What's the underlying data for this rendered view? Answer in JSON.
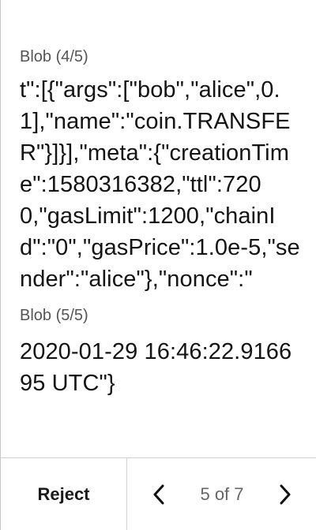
{
  "blob4": {
    "label": "Blob (4/5)",
    "text": "t\":[{\"args\":[\"bob\",\"alice\",0.1],\"name\":\"coin.TRANSFER\"}]}],\"meta\":{\"creationTime\":1580316382,\"ttl\":7200,\"gasLimit\":1200,\"chainId\":\"0\",\"gasPrice\":1.0e-5,\"sender\":\"alice\"},\"nonce\":\""
  },
  "blob5": {
    "label": "Blob (5/5)",
    "text": "2020-01-29 16:46:22.916695 UTC\"}"
  },
  "footer": {
    "reject_label": "Reject",
    "page_indicator": "5 of 7"
  },
  "icons": {
    "prev": "chevron-left-icon",
    "next": "chevron-right-icon"
  }
}
